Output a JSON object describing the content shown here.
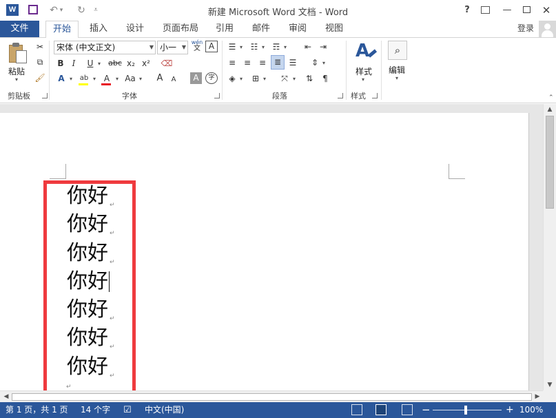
{
  "window": {
    "title": "新建 Microsoft Word 文档 - Word",
    "help": "?",
    "app_icon": "W"
  },
  "tabs": {
    "file": "文件",
    "items": [
      "开始",
      "插入",
      "设计",
      "页面布局",
      "引用",
      "邮件",
      "审阅",
      "视图"
    ],
    "active": "开始",
    "login": "登录"
  },
  "ribbon": {
    "clipboard": {
      "paste": "粘贴",
      "group": "剪贴板"
    },
    "font": {
      "font_name": "宋体 (中文正文)",
      "font_size": "小一",
      "wen": "wén",
      "wen_char": "文",
      "A": "A",
      "B": "B",
      "I": "I",
      "U": "U",
      "abc": "abc",
      "sub": "x₂",
      "sup": "x²",
      "aa": "Aa",
      "grow": "A",
      "shrink": "A",
      "ab": "ab",
      "circle": "字",
      "group": "字体",
      "highlight_color": "#ffff00",
      "font_color": "#e81123"
    },
    "paragraph": {
      "group": "段落"
    },
    "styles": {
      "label": "样式",
      "group": "样式"
    },
    "editing": {
      "label": "编辑"
    }
  },
  "document": {
    "lines": [
      "你好",
      "你好",
      "你好",
      "你好",
      "你好",
      "你好",
      "你好"
    ],
    "cursor_line": 3,
    "highlight_color": "#ef3a3e"
  },
  "statusbar": {
    "page": "第 1 页，共 1 页",
    "words": "14 个字",
    "language": "中文(中国)",
    "zoom_minus": "−",
    "zoom_plus": "+",
    "zoom": "100%",
    "zoom_level_percent": 100
  },
  "colors": {
    "brand": "#2b579a",
    "highlight_box": "#ef3a3e"
  },
  "icons": [
    "word-logo-icon",
    "save-icon",
    "undo-icon",
    "redo-icon",
    "customize-icon",
    "help-icon",
    "ribbon-options-icon",
    "minimize-icon",
    "maximize-icon",
    "close-icon",
    "avatar-icon",
    "cut-icon",
    "copy-icon",
    "format-painter-icon",
    "bullets-icon",
    "numbering-icon",
    "multilevel-list-icon",
    "decrease-indent-icon",
    "increase-indent-icon",
    "sort-icon",
    "show-marks-icon",
    "align-left-icon",
    "center-icon",
    "align-right-icon",
    "justify-icon",
    "distributed-icon",
    "line-spacing-icon",
    "shading-icon",
    "borders-icon",
    "binoculars-icon",
    "proofing-icon",
    "print-layout-icon",
    "read-mode-icon",
    "web-layout-icon"
  ]
}
